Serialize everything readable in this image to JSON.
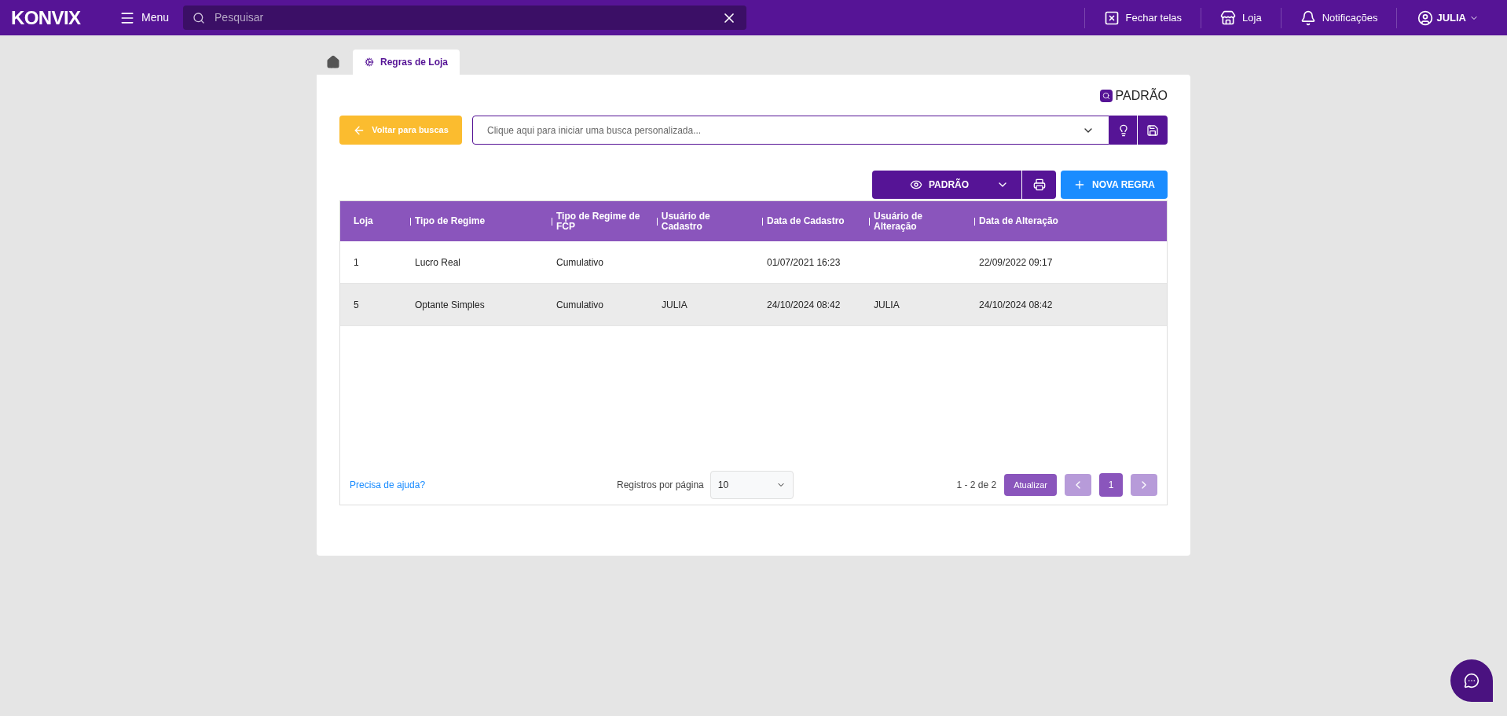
{
  "topbar": {
    "logo": "KONVIX",
    "menu": "Menu",
    "search": {
      "placeholder": "Pesquisar"
    },
    "actions": [
      {
        "kind": "close-screens",
        "label": "Fechar telas"
      },
      {
        "kind": "store",
        "label": "Loja"
      },
      {
        "kind": "bell",
        "label": "Notificações"
      }
    ],
    "user": "JULIA"
  },
  "tabs": [
    {
      "kind": "home",
      "selected": false
    },
    {
      "kind": "page",
      "label": "Regras de Loja",
      "selected": true
    }
  ],
  "view_badge": "PADRÃO",
  "back_button": "Voltar para buscas",
  "custom_search": {
    "placeholder": "Clique aqui para iniciar uma busca personalizada..."
  },
  "view_select": "PADRÃO",
  "new_button": "NOVA REGRA",
  "table": {
    "columns": [
      "Loja",
      "Tipo de Regime",
      "Tipo de Regime de FCP",
      "Usuário de Cadastro",
      "Data de Cadastro",
      "Usuário de Alteração",
      "Data de Alteração"
    ],
    "rows": [
      {
        "selected": false,
        "cells": [
          "1",
          "Lucro Real",
          "Cumulativo",
          "",
          "01/07/2021 16:23",
          "",
          "22/09/2022 09:17"
        ]
      },
      {
        "selected": true,
        "cells": [
          "5",
          "Optante Simples",
          "Cumulativo",
          "JULIA",
          "24/10/2024 08:42",
          "JULIA",
          "24/10/2024 08:42"
        ]
      }
    ]
  },
  "footer": {
    "help_link": "Precisa de ajuda?",
    "page_size_label": "Registros por página",
    "page_size": "10",
    "range": "1 - 2 de 2",
    "refresh": "Atualizar",
    "pages": [
      {
        "label": "1",
        "selected": true
      }
    ]
  }
}
